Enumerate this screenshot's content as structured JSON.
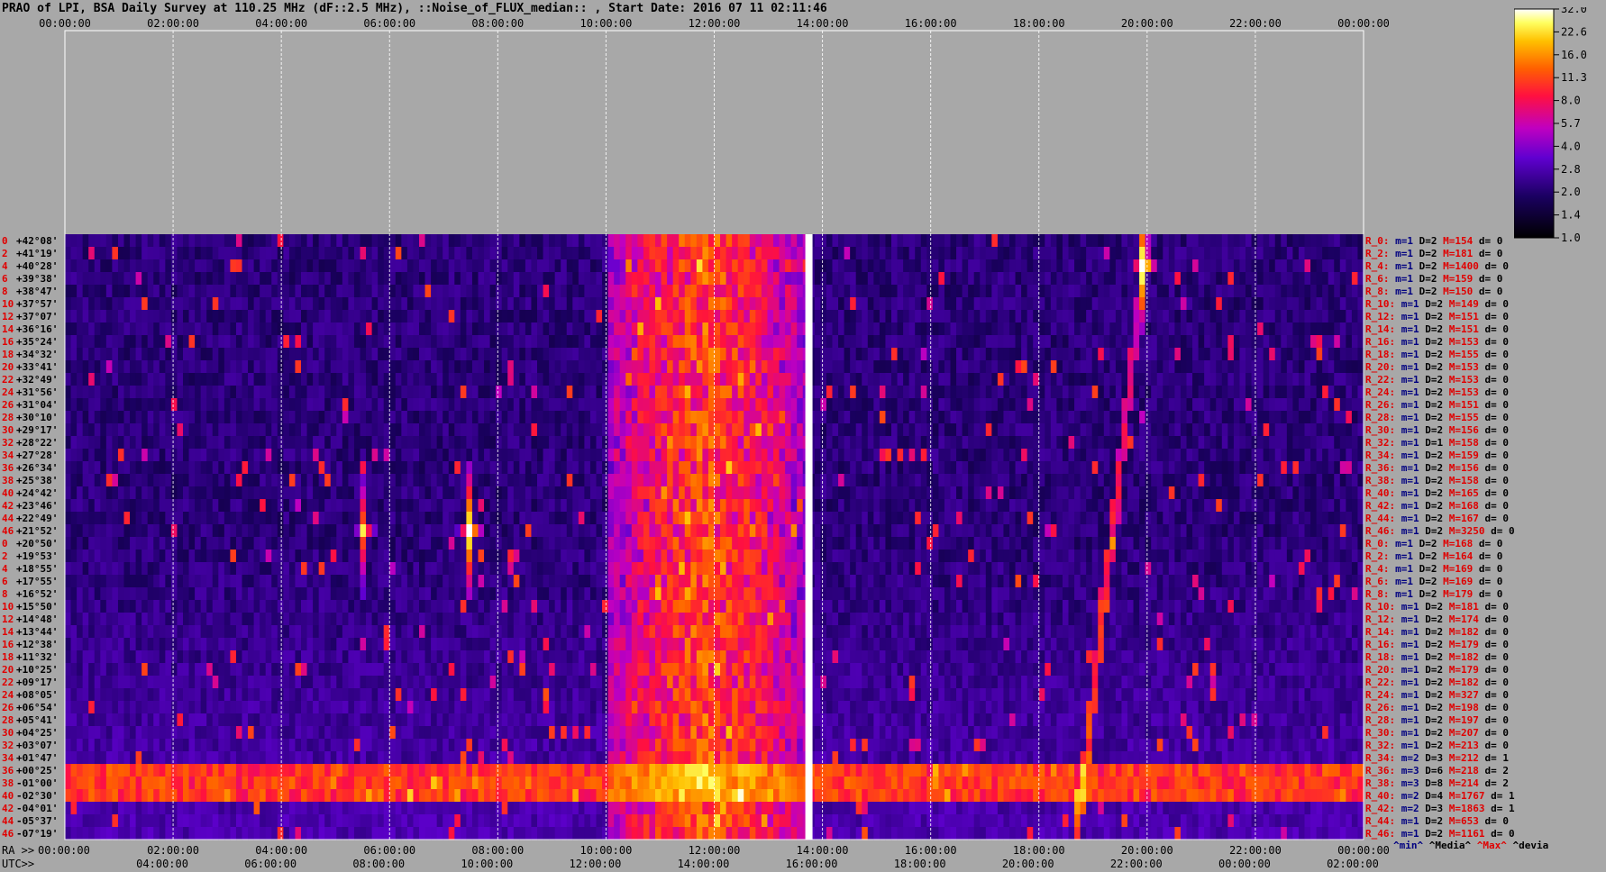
{
  "title": "PRAO of LPI, BSA Daily Survey at 110.25 MHz (dF::2.5 MHz), ::Noise_of_FLUX_median:: , Start Date: 2016 07 11 02:11:46",
  "chart_data": {
    "type": "heatmap",
    "top_axis_ticks": [
      "00:00:00",
      "02:00:00",
      "04:00:00",
      "06:00:00",
      "08:00:00",
      "10:00:00",
      "12:00:00",
      "14:00:00",
      "16:00:00",
      "18:00:00",
      "20:00:00",
      "22:00:00",
      "00:00:00"
    ],
    "ra_axis_label": "RA >>",
    "ra_axis_ticks": [
      "00:00:00",
      "02:00:00",
      "04:00:00",
      "06:00:00",
      "08:00:00",
      "10:00:00",
      "12:00:00",
      "14:00:00",
      "16:00:00",
      "18:00:00",
      "20:00:00",
      "22:00:00",
      "00:00:00"
    ],
    "utc_axis_label": "UTC>>",
    "utc_axis_ticks": [
      "04:00:00",
      "06:00:00",
      "08:00:00",
      "10:00:00",
      "12:00:00",
      "14:00:00",
      "16:00:00",
      "18:00:00",
      "20:00:00",
      "22:00:00",
      "00:00:00",
      "02:00:00"
    ],
    "row_numbers": [
      "0",
      "2",
      "4",
      "6",
      "8",
      "10",
      "12",
      "14",
      "16",
      "18",
      "20",
      "22",
      "24",
      "26",
      "28",
      "30",
      "32",
      "34",
      "36",
      "38",
      "40",
      "42",
      "44",
      "46",
      "0",
      "2",
      "4",
      "6",
      "8",
      "10",
      "12",
      "14",
      "16",
      "18",
      "20",
      "22",
      "24",
      "26",
      "28",
      "30",
      "32",
      "34",
      "36",
      "38",
      "40",
      "42",
      "44",
      "46"
    ],
    "declinations": [
      "+42°08'",
      "+41°19'",
      "+40°28'",
      "+39°38'",
      "+38°47'",
      "+37°57'",
      "+37°07'",
      "+36°16'",
      "+35°24'",
      "+34°32'",
      "+33°41'",
      "+32°49'",
      "+31°56'",
      "+31°04'",
      "+30°10'",
      "+29°17'",
      "+28°22'",
      "+27°28'",
      "+26°34'",
      "+25°38'",
      "+24°42'",
      "+23°46'",
      "+22°49'",
      "+21°52'",
      "+20°50'",
      "+19°53'",
      "+18°55'",
      "+17°55'",
      "+16°52'",
      "+15°50'",
      "+14°48'",
      "+13°44'",
      "+12°38'",
      "+11°32'",
      "+10°25'",
      "+09°17'",
      "+08°05'",
      "+06°54'",
      "+05°41'",
      "+04°25'",
      "+03°07'",
      "+01°47'",
      "+00°25'",
      "-01°00'",
      "-02°30'",
      "-04°01'",
      "-05°37'",
      "-07°19'"
    ],
    "row_stats": [
      {
        "r": "R_0:",
        "m": "m=1",
        "d": "D=2",
        "M": "M=154",
        "dv": "d= 0"
      },
      {
        "r": "R_2:",
        "m": "m=1",
        "d": "D=2",
        "M": "M=181",
        "dv": "d= 0"
      },
      {
        "r": "R_4:",
        "m": "m=1",
        "d": "D=2",
        "M": "M=1400",
        "dv": "d= 0"
      },
      {
        "r": "R_6:",
        "m": "m=1",
        "d": "D=2",
        "M": "M=159",
        "dv": "d= 0"
      },
      {
        "r": "R_8:",
        "m": "m=1",
        "d": "D=2",
        "M": "M=150",
        "dv": "d= 0"
      },
      {
        "r": "R_10:",
        "m": "m=1",
        "d": "D=2",
        "M": "M=149",
        "dv": "d= 0"
      },
      {
        "r": "R_12:",
        "m": "m=1",
        "d": "D=2",
        "M": "M=151",
        "dv": "d= 0"
      },
      {
        "r": "R_14:",
        "m": "m=1",
        "d": "D=2",
        "M": "M=151",
        "dv": "d= 0"
      },
      {
        "r": "R_16:",
        "m": "m=1",
        "d": "D=2",
        "M": "M=153",
        "dv": "d= 0"
      },
      {
        "r": "R_18:",
        "m": "m=1",
        "d": "D=2",
        "M": "M=155",
        "dv": "d= 0"
      },
      {
        "r": "R_20:",
        "m": "m=1",
        "d": "D=2",
        "M": "M=153",
        "dv": "d= 0"
      },
      {
        "r": "R_22:",
        "m": "m=1",
        "d": "D=2",
        "M": "M=153",
        "dv": "d= 0"
      },
      {
        "r": "R_24:",
        "m": "m=1",
        "d": "D=2",
        "M": "M=153",
        "dv": "d= 0"
      },
      {
        "r": "R_26:",
        "m": "m=1",
        "d": "D=2",
        "M": "M=151",
        "dv": "d= 0"
      },
      {
        "r": "R_28:",
        "m": "m=1",
        "d": "D=2",
        "M": "M=155",
        "dv": "d= 0"
      },
      {
        "r": "R_30:",
        "m": "m=1",
        "d": "D=2",
        "M": "M=156",
        "dv": "d= 0"
      },
      {
        "r": "R_32:",
        "m": "m=1",
        "d": "D=1",
        "M": "M=158",
        "dv": "d= 0"
      },
      {
        "r": "R_34:",
        "m": "m=1",
        "d": "D=2",
        "M": "M=159",
        "dv": "d= 0"
      },
      {
        "r": "R_36:",
        "m": "m=1",
        "d": "D=2",
        "M": "M=156",
        "dv": "d= 0"
      },
      {
        "r": "R_38:",
        "m": "m=1",
        "d": "D=2",
        "M": "M=158",
        "dv": "d= 0"
      },
      {
        "r": "R_40:",
        "m": "m=1",
        "d": "D=2",
        "M": "M=165",
        "dv": "d= 0"
      },
      {
        "r": "R_42:",
        "m": "m=1",
        "d": "D=2",
        "M": "M=168",
        "dv": "d= 0"
      },
      {
        "r": "R_44:",
        "m": "m=1",
        "d": "D=2",
        "M": "M=167",
        "dv": "d= 0"
      },
      {
        "r": "R_46:",
        "m": "m=1",
        "d": "D=2",
        "M": "M=3250",
        "dv": "d= 0"
      },
      {
        "r": "R_0:",
        "m": "m=1",
        "d": "D=2",
        "M": "M=168",
        "dv": "d= 0"
      },
      {
        "r": "R_2:",
        "m": "m=1",
        "d": "D=2",
        "M": "M=164",
        "dv": "d= 0"
      },
      {
        "r": "R_4:",
        "m": "m=1",
        "d": "D=2",
        "M": "M=169",
        "dv": "d= 0"
      },
      {
        "r": "R_6:",
        "m": "m=1",
        "d": "D=2",
        "M": "M=169",
        "dv": "d= 0"
      },
      {
        "r": "R_8:",
        "m": "m=1",
        "d": "D=2",
        "M": "M=179",
        "dv": "d= 0"
      },
      {
        "r": "R_10:",
        "m": "m=1",
        "d": "D=2",
        "M": "M=181",
        "dv": "d= 0"
      },
      {
        "r": "R_12:",
        "m": "m=1",
        "d": "D=2",
        "M": "M=174",
        "dv": "d= 0"
      },
      {
        "r": "R_14:",
        "m": "m=1",
        "d": "D=2",
        "M": "M=182",
        "dv": "d= 0"
      },
      {
        "r": "R_16:",
        "m": "m=1",
        "d": "D=2",
        "M": "M=179",
        "dv": "d= 0"
      },
      {
        "r": "R_18:",
        "m": "m=1",
        "d": "D=2",
        "M": "M=182",
        "dv": "d= 0"
      },
      {
        "r": "R_20:",
        "m": "m=1",
        "d": "D=2",
        "M": "M=179",
        "dv": "d= 0"
      },
      {
        "r": "R_22:",
        "m": "m=1",
        "d": "D=2",
        "M": "M=182",
        "dv": "d= 0"
      },
      {
        "r": "R_24:",
        "m": "m=1",
        "d": "D=2",
        "M": "M=327",
        "dv": "d= 0"
      },
      {
        "r": "R_26:",
        "m": "m=1",
        "d": "D=2",
        "M": "M=198",
        "dv": "d= 0"
      },
      {
        "r": "R_28:",
        "m": "m=1",
        "d": "D=2",
        "M": "M=197",
        "dv": "d= 0"
      },
      {
        "r": "R_30:",
        "m": "m=1",
        "d": "D=2",
        "M": "M=207",
        "dv": "d= 0"
      },
      {
        "r": "R_32:",
        "m": "m=1",
        "d": "D=2",
        "M": "M=213",
        "dv": "d= 0"
      },
      {
        "r": "R_34:",
        "m": "m=2",
        "d": "D=3",
        "M": "M=212",
        "dv": "d= 1"
      },
      {
        "r": "R_36:",
        "m": "m=3",
        "d": "D=6",
        "M": "M=218",
        "dv": "d= 2"
      },
      {
        "r": "R_38:",
        "m": "m=3",
        "d": "D=8",
        "M": "M=214",
        "dv": "d= 2"
      },
      {
        "r": "R_40:",
        "m": "m=2",
        "d": "D=4",
        "M": "M=1767",
        "dv": "d= 1"
      },
      {
        "r": "R_42:",
        "m": "m=2",
        "d": "D=3",
        "M": "M=1863",
        "dv": "d= 1"
      },
      {
        "r": "R_44:",
        "m": "m=1",
        "d": "D=2",
        "M": "M=653",
        "dv": "d= 0"
      },
      {
        "r": "R_46:",
        "m": "m=1",
        "d": "D=2",
        "M": "M=1161",
        "dv": "d= 0"
      }
    ],
    "stats_footer": {
      "min": "^min^",
      "media": "^Media^",
      "max": "^Max^",
      "devia": "^devia"
    },
    "colorbar_ticks": [
      "32.0",
      "22.6",
      "16.0",
      "11.3",
      "8.0",
      "5.7",
      "4.0",
      "2.8",
      "2.0",
      "1.4",
      "1.0"
    ],
    "colorbar_range": [
      1.0,
      32.0
    ],
    "colorbar_scale": "log",
    "features": [
      {
        "kind": "broad_band",
        "ra_h": [
          10.0,
          13.7
        ],
        "dec_rows": [
          0,
          47
        ],
        "level": 22
      },
      {
        "kind": "vertical_line",
        "ra_h": 13.75,
        "dec_rows": [
          0,
          47
        ],
        "level": 32
      },
      {
        "kind": "horizontal_band",
        "ra_h": [
          0,
          24
        ],
        "dec_rows": [
          42,
          44
        ],
        "level": 10
      },
      {
        "kind": "point_source",
        "ra_h": 7.5,
        "dec_row": 23,
        "level": 32
      },
      {
        "kind": "point_source",
        "ra_h": 19.95,
        "dec_row": 2,
        "level": 32
      },
      {
        "kind": "point_source",
        "ra_h": 5.55,
        "dec_row": 23,
        "level": 14
      },
      {
        "kind": "diagonal_track",
        "ra_h": [
          20.0,
          18.7
        ],
        "dec_rows": [
          0,
          47
        ],
        "level": 8
      }
    ]
  },
  "colors": {
    "background": "#a8a8a8",
    "grid": "#ffffff",
    "label_red": "#e00000",
    "label_blue": "#000080",
    "label_black": "#000000"
  }
}
